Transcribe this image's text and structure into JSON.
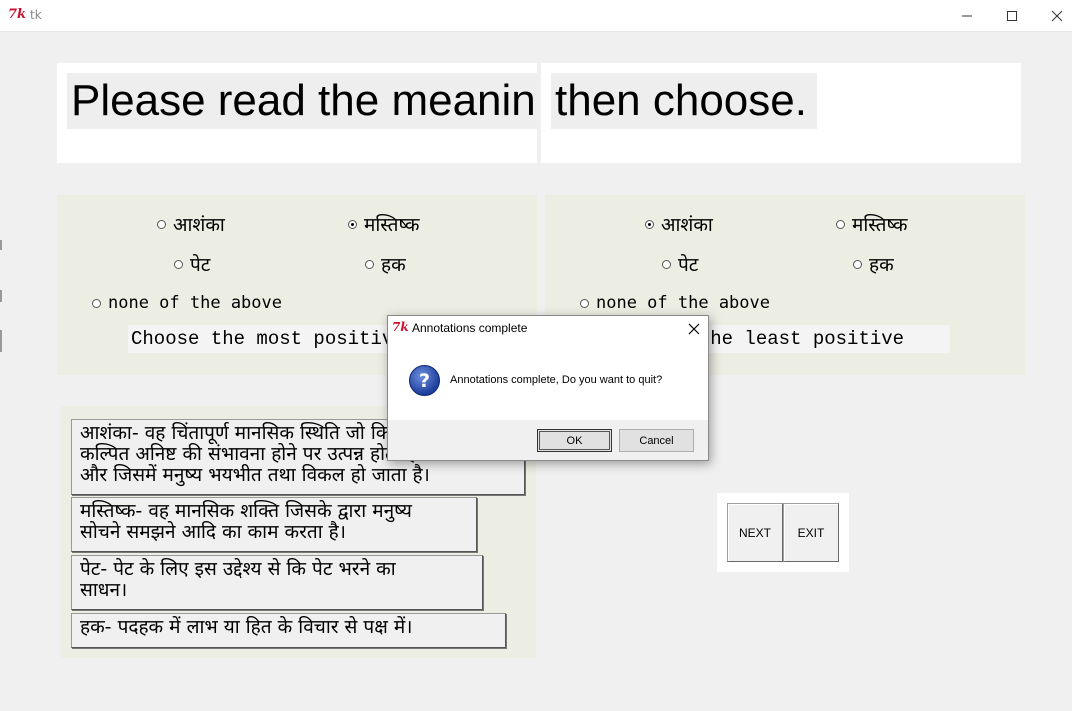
{
  "window": {
    "title": "tk",
    "logo_text": "7k"
  },
  "banner": {
    "left_text": "Please read the meaning",
    "right_text": "then choose."
  },
  "left_panel": {
    "options": [
      {
        "label": "आशंका",
        "selected": false
      },
      {
        "label": "मस्तिष्क",
        "selected": true
      },
      {
        "label": "पेट",
        "selected": false
      },
      {
        "label": "हक",
        "selected": false
      },
      {
        "label": "none of the above",
        "selected": false
      }
    ],
    "instruction": "Choose the most positive"
  },
  "right_panel": {
    "options": [
      {
        "label": "आशंका",
        "selected": true
      },
      {
        "label": "मस्तिष्क",
        "selected": false
      },
      {
        "label": "पेट",
        "selected": false
      },
      {
        "label": "हक",
        "selected": false
      },
      {
        "label": "none of the above",
        "selected": false
      }
    ],
    "instruction": "Choose the least positive"
  },
  "meanings": [
    {
      "line1": "आशंका- वह चिंतापूर्ण मानसिक स्थिति जो किसी",
      "line2": "कल्पित अनिष्ट की संभावना होने पर उत्पन्न होती है",
      "line3": "और जिसमें मनुष्य भयभीत तथा विकल हो जाता है।"
    },
    {
      "line1": "मस्तिष्क- वह मानसिक शक्ति जिसके द्वारा मनुष्य",
      "line2": "सोचने समझने आदि का काम करता है।"
    },
    {
      "line1": "पेट- पेट के लिए इस उद्देश्य से कि पेट भरने का",
      "line2": "साधन।"
    },
    {
      "line1": "हक- पदहक में  लाभ या हित के विचार से पक्ष में।"
    }
  ],
  "nav": {
    "next_label": "NEXT",
    "exit_label": "EXIT"
  },
  "dialog": {
    "title": "Annotations complete",
    "message": "Annotations complete, Do you want to quit?",
    "ok_label": "OK",
    "cancel_label": "Cancel",
    "icon": "question-icon"
  }
}
